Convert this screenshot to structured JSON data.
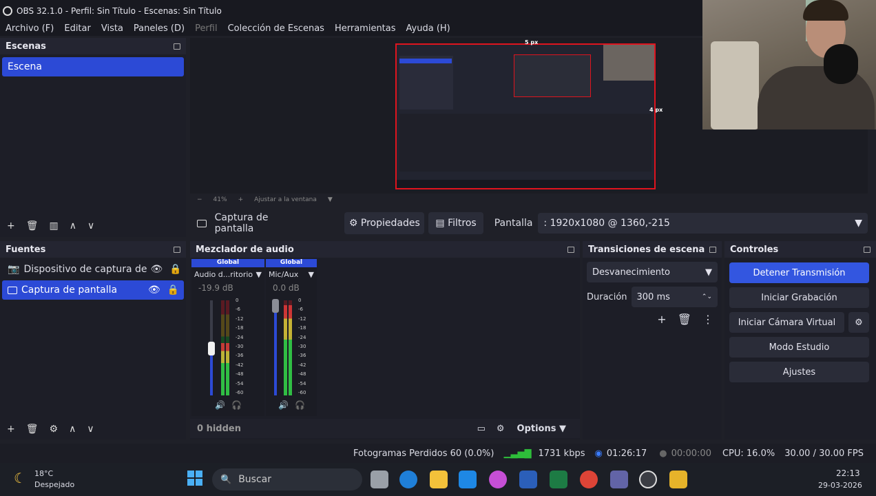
{
  "window": {
    "title": "OBS 32.1.0 - Perfil: Sin Título - Escenas: Sin Título"
  },
  "menu": [
    "Archivo (F)",
    "Editar",
    "Vista",
    "Paneles (D)",
    "Perfil",
    "Colección de Escenas",
    "Herramientas",
    "Ayuda (H)"
  ],
  "scenes": {
    "title": "Escenas",
    "items": [
      "Escena"
    ]
  },
  "sources": {
    "title": "Fuentes",
    "items": [
      "Dispositivo de captura de vide",
      "Captura de pantalla"
    ]
  },
  "preview": {
    "zoom": "41%",
    "fit_label": "Ajustar a la ventana",
    "px_top": "5 px",
    "px_right": "4 px"
  },
  "source_bar": {
    "name": "Captura de pantalla",
    "properties": "Propiedades",
    "filters": "Filtros",
    "display_label": "Pantalla",
    "display_value": ": 1920x1080 @ 1360,-215"
  },
  "mixer": {
    "title": "Mezclador de audio",
    "channels": [
      {
        "tag": "Global",
        "name": "Audio d...ritorio",
        "db": "-19.9 dB",
        "level": 0.55
      },
      {
        "tag": "Global",
        "name": "Mic/Aux",
        "db": "0.0 dB",
        "level": 0.95
      }
    ],
    "scale": [
      "0",
      "-6",
      "-12",
      "-18",
      "-24",
      "-30",
      "-36",
      "-42",
      "-48",
      "-54",
      "-60"
    ],
    "hidden": "0 hidden",
    "options": "Options"
  },
  "transitions": {
    "title": "Transiciones de escena",
    "selected": "Desvanecimiento",
    "duration_label": "Duración",
    "duration_value": "300 ms"
  },
  "controls": {
    "title": "Controles",
    "stop_stream": "Detener Transmisión",
    "start_record": "Iniciar Grabación",
    "virtual_cam": "Iniciar Cámara Virtual",
    "studio": "Modo Estudio",
    "settings": "Ajustes"
  },
  "status": {
    "dropped": "Fotogramas Perdidos 60 (0.0%)",
    "kbps": "1731 kbps",
    "stream_time": "01:26:17",
    "rec_time": "00:00:00",
    "cpu": "CPU: 16.0%",
    "fps": "30.00 / 30.00 FPS"
  },
  "taskbar": {
    "temp": "18°C",
    "weather": "Despejado",
    "search": "Buscar",
    "time": "22:13",
    "date": "29-03-2026"
  },
  "colors": {
    "accent": "#2c4ad6",
    "selection_red": "#e0141e"
  }
}
